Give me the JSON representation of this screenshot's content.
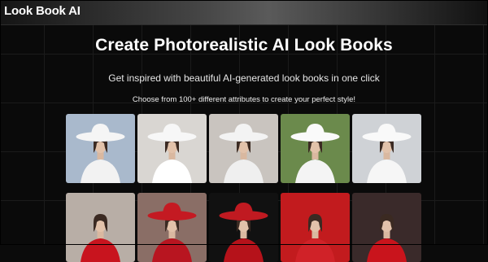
{
  "header": {
    "logo": "Look Book AI"
  },
  "hero": {
    "title": "Create Photorealistic AI Look Books",
    "subtitle": "Get inspired with beautiful AI-generated look books in one click",
    "tagline": "Choose from 100+ different attributes to create your perfect style!"
  },
  "gallery": {
    "row1": [
      {
        "icon": "model-white-hat-male-photo",
        "bg": "#a9b9cc",
        "outfit": "#f2f2f2",
        "hat": "#f5f5f5"
      },
      {
        "icon": "model-white-hat-photo",
        "bg": "#d9d6d2",
        "outfit": "#ffffff",
        "hat": "#f7f7f7"
      },
      {
        "icon": "model-white-hat-photo",
        "bg": "#c9c4bf",
        "outfit": "#efefef",
        "hat": "#f3f3f3"
      },
      {
        "icon": "model-white-hat-photo",
        "bg": "#6b8a4c",
        "outfit": "#f4f4f4",
        "hat": "#fafafa"
      },
      {
        "icon": "model-white-hat-photo",
        "bg": "#cfd2d6",
        "outfit": "#f6f6f6",
        "hat": "#f9f9f9"
      }
    ],
    "row2": [
      {
        "icon": "model-red-dress-photo",
        "bg": "#b8aea6",
        "outfit": "#c8141e",
        "hat": ""
      },
      {
        "icon": "model-red-hat-photo",
        "bg": "#8a6e66",
        "outfit": "#b81520",
        "hat": "#c41a22"
      },
      {
        "icon": "model-red-hat-photo",
        "bg": "#111111",
        "outfit": "#b5121a",
        "hat": "#c01a21"
      },
      {
        "icon": "model-red-dress-photo",
        "bg": "#c21b1e",
        "outfit": "#d02228",
        "hat": ""
      },
      {
        "icon": "model-red-dress-photo",
        "bg": "#3a2a2a",
        "outfit": "#c9141c",
        "hat": ""
      }
    ]
  }
}
